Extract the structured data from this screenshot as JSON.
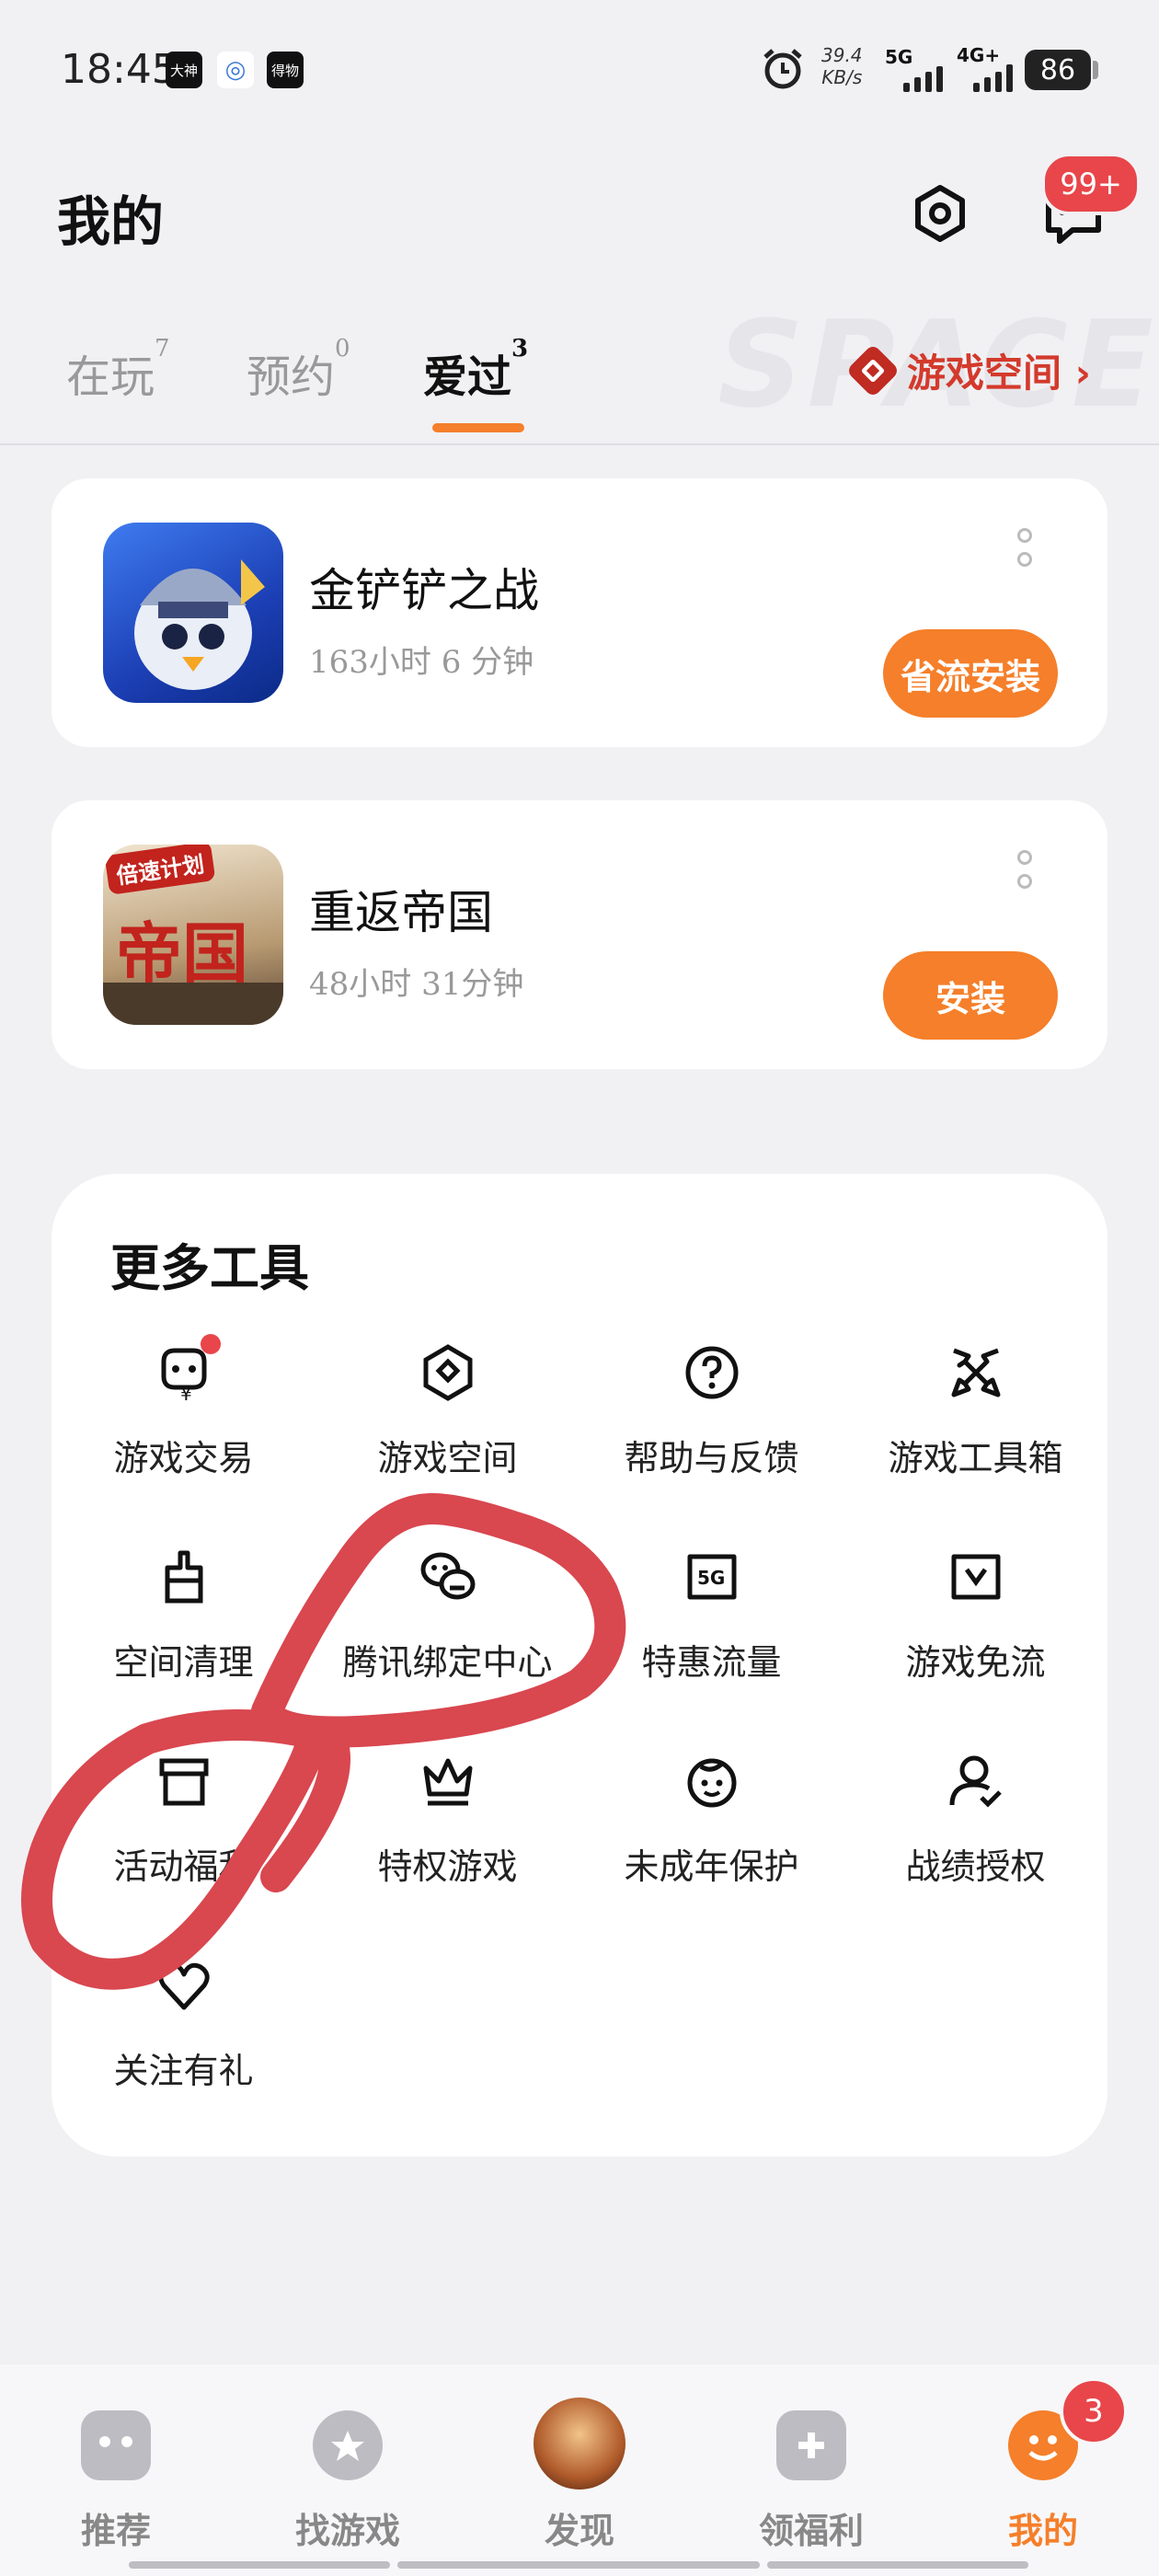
{
  "status_bar": {
    "time": "18:45",
    "app_icons": [
      "大神",
      "◎",
      "得物"
    ],
    "net_speed": "39.4",
    "net_unit": "KB/s",
    "signal1": "5G",
    "signal2": "4G+",
    "battery": "86"
  },
  "header": {
    "title": "我的",
    "message_badge": "99+"
  },
  "tabs": [
    {
      "label": "在玩",
      "count": "7"
    },
    {
      "label": "预约",
      "count": "0"
    },
    {
      "label": "爱过",
      "count": "3"
    }
  ],
  "watermark": "SPACE",
  "game_space_link": "游戏空间 ›",
  "games": [
    {
      "name": "金铲铲之战",
      "time": "163小时 6 分钟",
      "button": "省流安装"
    },
    {
      "name": "重返帝国",
      "time": "48小时 31分钟",
      "button": "安装",
      "icon_text": "帝国",
      "icon_tag": "倍速计划"
    }
  ],
  "tools": {
    "title": "更多工具",
    "items": [
      {
        "label": "游戏交易",
        "icon": "trade-icon"
      },
      {
        "label": "游戏空间",
        "icon": "game-space-icon"
      },
      {
        "label": "帮助与反馈",
        "icon": "help-icon"
      },
      {
        "label": "游戏工具箱",
        "icon": "toolbox-icon"
      },
      {
        "label": "空间清理",
        "icon": "clean-icon"
      },
      {
        "label": "腾讯绑定中心",
        "icon": "tencent-bind-icon"
      },
      {
        "label": "特惠流量",
        "icon": "data-5g-icon"
      },
      {
        "label": "游戏免流",
        "icon": "free-data-icon"
      },
      {
        "label": "活动福利",
        "icon": "gift-box-icon"
      },
      {
        "label": "特权游戏",
        "icon": "crown-icon"
      },
      {
        "label": "未成年保护",
        "icon": "child-protect-icon"
      },
      {
        "label": "战绩授权",
        "icon": "user-auth-icon"
      },
      {
        "label": "关注有礼",
        "icon": "heart-icon"
      }
    ]
  },
  "bottom_nav": [
    {
      "label": "推荐",
      "icon": "gamepad-icon"
    },
    {
      "label": "找游戏",
      "icon": "find-game-icon"
    },
    {
      "label": "发现",
      "icon": "discover-avatar-icon"
    },
    {
      "label": "领福利",
      "icon": "welfare-icon"
    },
    {
      "label": "我的",
      "icon": "me-icon",
      "active": true
    }
  ],
  "bottom_badge": "3",
  "colors": {
    "accent": "#f57f2a",
    "badge": "#e8464a",
    "annotation": "#d9474f"
  }
}
